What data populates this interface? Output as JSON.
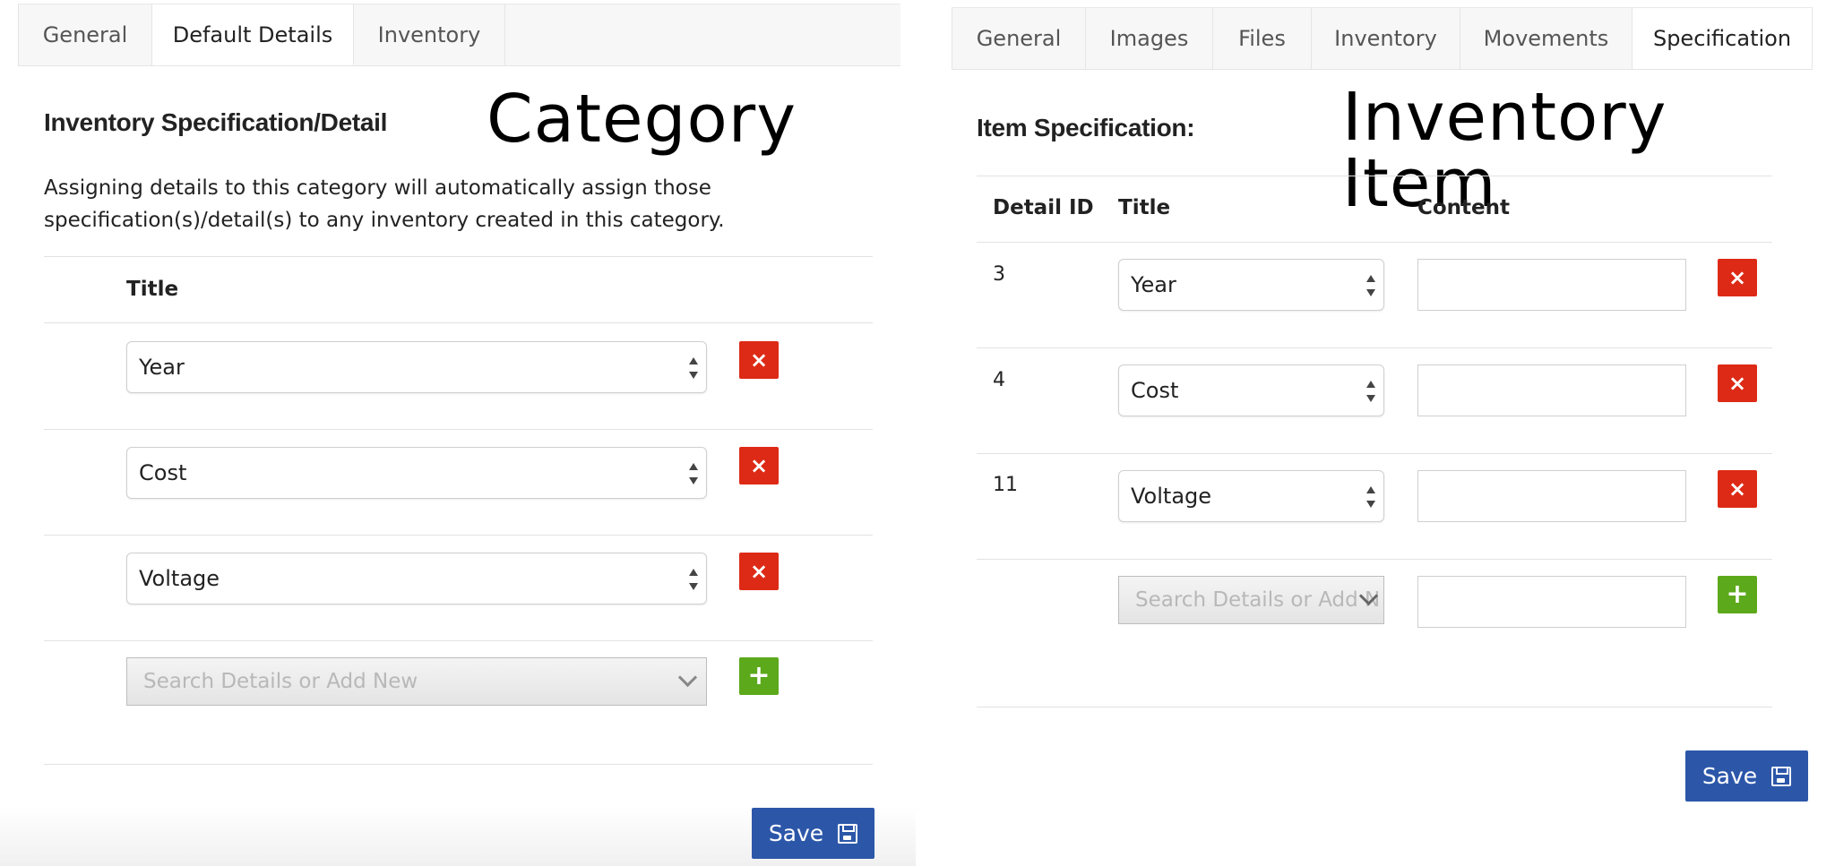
{
  "category_panel": {
    "tabs": [
      {
        "label": "General",
        "active": false
      },
      {
        "label": "Default Details",
        "active": true
      },
      {
        "label": "Inventory",
        "active": false
      }
    ],
    "heading": "Inventory Specification/Detail",
    "overlay_label": "Category",
    "description": "Assigning details to this category will automatically assign those specification(s)/detail(s) to any inventory created in this category.",
    "column_title": "Title",
    "rows": [
      {
        "title": "Year"
      },
      {
        "title": "Cost"
      },
      {
        "title": "Voltage"
      }
    ],
    "search_placeholder": "Search Details or Add New",
    "save_label": "Save"
  },
  "item_panel": {
    "tabs": [
      {
        "label": "General",
        "active": false
      },
      {
        "label": "Images",
        "active": false
      },
      {
        "label": "Files",
        "active": false
      },
      {
        "label": "Inventory",
        "active": false
      },
      {
        "label": "Movements",
        "active": false
      },
      {
        "label": "Specification",
        "active": true
      }
    ],
    "heading": "Item Specification:",
    "overlay_label": "Inventory Item",
    "columns": {
      "detail_id": "Detail ID",
      "title": "Title",
      "content": "Content"
    },
    "rows": [
      {
        "detail_id": "3",
        "title": "Year",
        "content": ""
      },
      {
        "detail_id": "4",
        "title": "Cost",
        "content": ""
      },
      {
        "detail_id": "11",
        "title": "Voltage",
        "content": ""
      }
    ],
    "search_placeholder": "Search Details or Add N",
    "save_label": "Save"
  },
  "colors": {
    "delete": "#dd2a16",
    "add": "#5ca91b",
    "save": "#2c57a9"
  },
  "icons": {
    "delete": "×",
    "add": "+",
    "save": "floppy-disk"
  }
}
